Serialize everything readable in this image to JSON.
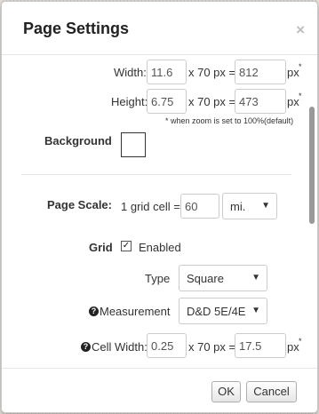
{
  "dialog": {
    "title": "Page Settings",
    "close_glyph": "×"
  },
  "width_row": {
    "label": "Width:",
    "cells_value": "11.6",
    "multiplier": "x 70 px =",
    "px_value": "812",
    "unit": "px",
    "marker": "*"
  },
  "height_row": {
    "label": "Height:",
    "cells_value": "6.75",
    "multiplier": "x 70 px =",
    "px_value": "473",
    "unit": "px",
    "marker": "*"
  },
  "zoom_note": "* when zoom is set to 100%(default)",
  "background": {
    "label": "Background",
    "color": "#ffffff"
  },
  "page_scale": {
    "label": "Page Scale:",
    "text": "1 grid cell =",
    "value": "60",
    "unit": "mi."
  },
  "grid": {
    "label": "Grid",
    "checkbox_checked": true,
    "enabled_label": "Enabled"
  },
  "type": {
    "label": "Type",
    "value": "Square"
  },
  "measurement": {
    "label": "Measurement",
    "value": "D&D 5E/4E"
  },
  "cell_width": {
    "label": "Cell Width:",
    "cells_value": "0.25",
    "multiplier": "x 70 px =",
    "px_value": "17.5",
    "unit": "px",
    "marker": "*"
  },
  "footer": {
    "ok_label": "OK",
    "cancel_label": "Cancel"
  }
}
